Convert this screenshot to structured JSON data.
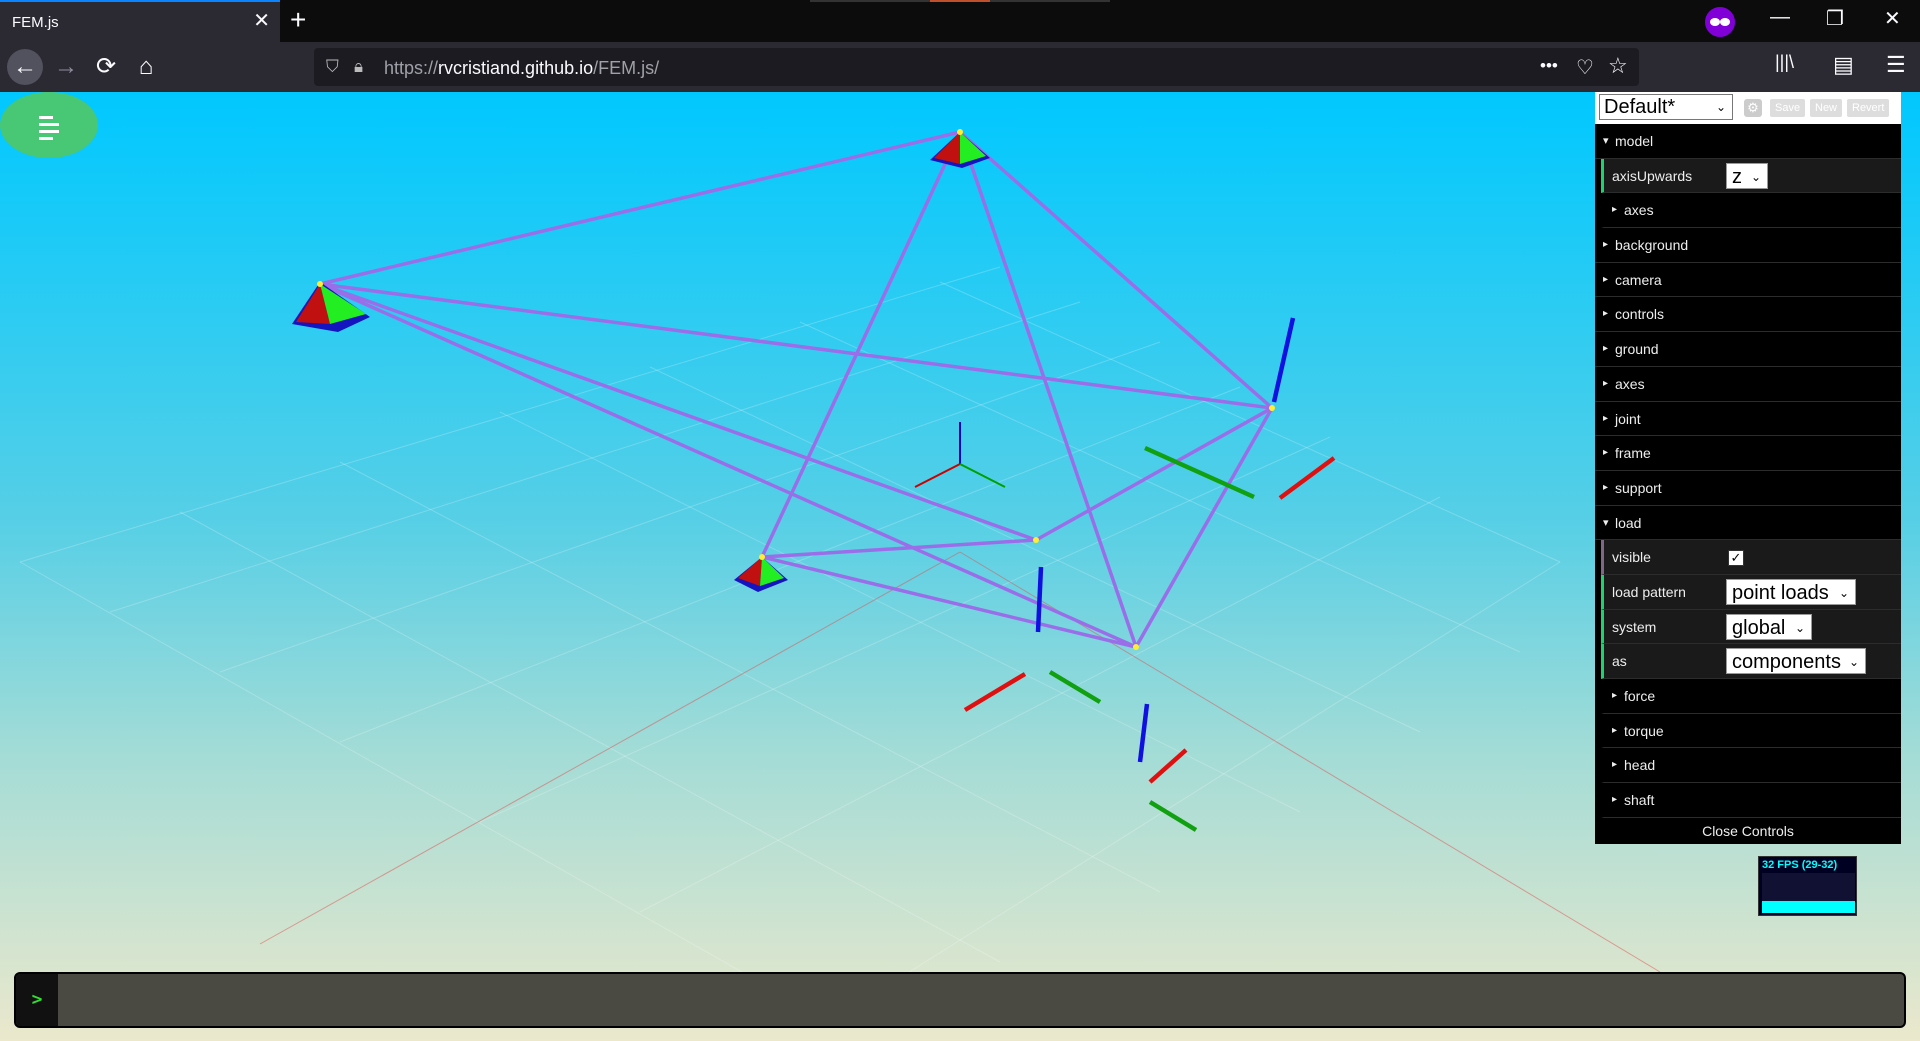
{
  "tab": {
    "title": "FEM.js",
    "close": "✕",
    "new": "+"
  },
  "window": {
    "minimize": "—",
    "restore": "❐",
    "close": "✕"
  },
  "nav": {
    "back": "←",
    "forward": "→",
    "reload": "⟳",
    "home": "⌂",
    "url_prefix": "https://",
    "url_host": "rvcristiand.github.io",
    "url_path": "/FEM.js/",
    "more": "•••",
    "pocket": "♡",
    "bookmark": "☆",
    "library": "|||\\",
    "sidebar": "▤",
    "menu": "☰"
  },
  "gui": {
    "preset": "Default*",
    "gear": "⚙",
    "save": "Save",
    "new": "New",
    "revert": "Revert",
    "model_label": "model",
    "axisUpwards_label": "axisUpwards",
    "axisUpwards_value": "z",
    "axes_sub_label": "axes",
    "background_label": "background",
    "camera_label": "camera",
    "controls_label": "controls",
    "ground_label": "ground",
    "axes_label": "axes",
    "joint_label": "joint",
    "frame_label": "frame",
    "support_label": "support",
    "load_label": "load",
    "visible_label": "visible",
    "visible_value": "✓",
    "load_pattern_label": "load pattern",
    "load_pattern_value": "point loads",
    "system_label": "system",
    "system_value": "global",
    "as_label": "as",
    "as_value": "components",
    "force_label": "force",
    "torque_label": "torque",
    "head_label": "head",
    "shaft_label": "shaft",
    "close_label": "Close Controls"
  },
  "fps": {
    "text": "32 FPS (29-32)"
  },
  "console": {
    "prompt": ">"
  },
  "colors": {
    "frame": "#9a6ee8",
    "force_x": "#e01010",
    "force_y": "#10a010",
    "force_z": "#1010e0",
    "support": "#20e020"
  }
}
